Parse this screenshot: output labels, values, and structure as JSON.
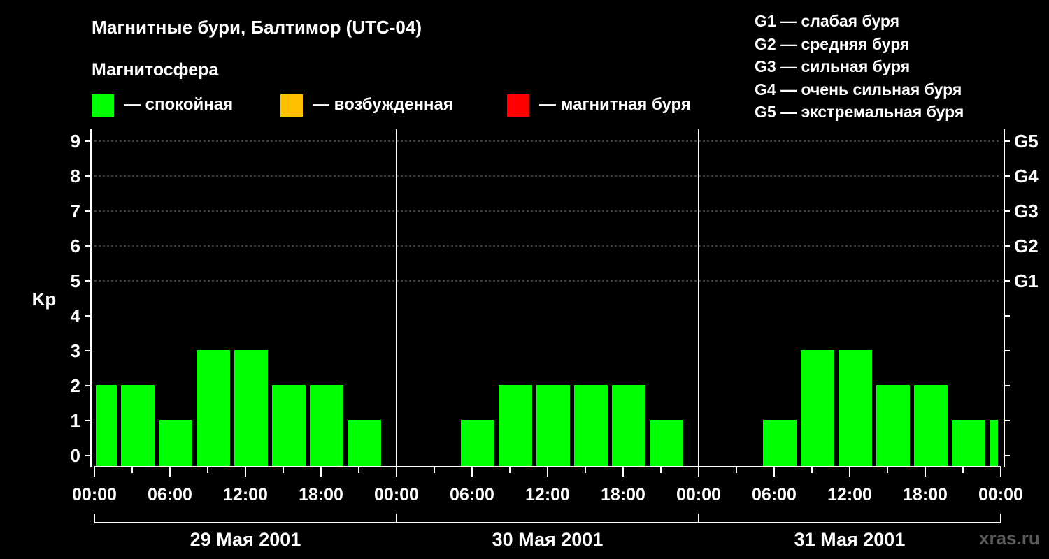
{
  "title": "Магнитные бури, Балтимор (UTC-04)",
  "subtitle": "Магнитосфера",
  "legend": [
    {
      "label": "— спокойная",
      "color": "#00ff00"
    },
    {
      "label": "— возбужденная",
      "color": "#ffc000"
    },
    {
      "label": "— магнитная буря",
      "color": "#ff0000"
    }
  ],
  "g_scale": [
    "G1 — слабая буря",
    "G2 — средняя буря",
    "G3 — сильная буря",
    "G4 — очень сильная буря",
    "G5 — экстремальная буря"
  ],
  "watermark": "xras.ru",
  "chart_data": {
    "type": "bar",
    "ylabel": "Kp",
    "ylim": [
      0,
      9
    ],
    "y_ticks": [
      "0",
      "1",
      "2",
      "3",
      "4",
      "5",
      "6",
      "7",
      "8",
      "9"
    ],
    "right_ticks": [
      {
        "kp": 5,
        "label": "G1"
      },
      {
        "kp": 6,
        "label": "G2"
      },
      {
        "kp": 7,
        "label": "G3"
      },
      {
        "kp": 8,
        "label": "G4"
      },
      {
        "kp": 9,
        "label": "G5"
      }
    ],
    "x_time_labels": [
      "00:00",
      "06:00",
      "12:00",
      "18:00",
      "00:00",
      "06:00",
      "12:00",
      "18:00",
      "00:00",
      "06:00",
      "12:00",
      "18:00",
      "00:00"
    ],
    "days": [
      "29 Мая 2001",
      "30 Мая 2001",
      "31 Мая 2001"
    ],
    "grid": "dashed horizontal at Kp 5-9",
    "bar_color": "#00ff00",
    "series": [
      {
        "start_hour": 0,
        "end_hour": 2,
        "kp": 2
      },
      {
        "start_hour": 2,
        "end_hour": 5,
        "kp": 2
      },
      {
        "start_hour": 5,
        "end_hour": 8,
        "kp": 1
      },
      {
        "start_hour": 8,
        "end_hour": 11,
        "kp": 3
      },
      {
        "start_hour": 11,
        "end_hour": 14,
        "kp": 3
      },
      {
        "start_hour": 14,
        "end_hour": 17,
        "kp": 2
      },
      {
        "start_hour": 17,
        "end_hour": 20,
        "kp": 2
      },
      {
        "start_hour": 20,
        "end_hour": 23,
        "kp": 1
      },
      {
        "start_hour": 23,
        "end_hour": 26,
        "kp": 0
      },
      {
        "start_hour": 26,
        "end_hour": 29,
        "kp": 0
      },
      {
        "start_hour": 29,
        "end_hour": 32,
        "kp": 1
      },
      {
        "start_hour": 32,
        "end_hour": 35,
        "kp": 2
      },
      {
        "start_hour": 35,
        "end_hour": 38,
        "kp": 2
      },
      {
        "start_hour": 38,
        "end_hour": 41,
        "kp": 2
      },
      {
        "start_hour": 41,
        "end_hour": 44,
        "kp": 2
      },
      {
        "start_hour": 44,
        "end_hour": 47,
        "kp": 1
      },
      {
        "start_hour": 47,
        "end_hour": 50,
        "kp": 0
      },
      {
        "start_hour": 50,
        "end_hour": 53,
        "kp": 0
      },
      {
        "start_hour": 53,
        "end_hour": 56,
        "kp": 1
      },
      {
        "start_hour": 56,
        "end_hour": 59,
        "kp": 3
      },
      {
        "start_hour": 59,
        "end_hour": 62,
        "kp": 3
      },
      {
        "start_hour": 62,
        "end_hour": 65,
        "kp": 2
      },
      {
        "start_hour": 65,
        "end_hour": 68,
        "kp": 2
      },
      {
        "start_hour": 68,
        "end_hour": 71,
        "kp": 1
      },
      {
        "start_hour": 71,
        "end_hour": 72,
        "kp": 1
      }
    ]
  }
}
